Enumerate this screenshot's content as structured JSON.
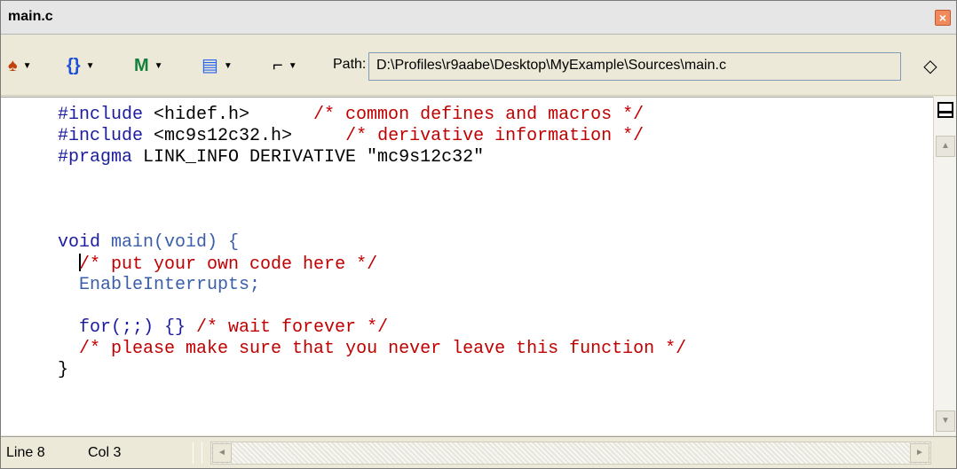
{
  "window": {
    "title": "main.c",
    "close_glyph": "×"
  },
  "toolbar": {
    "icons": [
      {
        "name": "debug-icon",
        "glyph": "♠",
        "color": "#c2410c"
      },
      {
        "name": "braces-icon",
        "glyph": "{}",
        "color": "#1d4ed8"
      },
      {
        "name": "make-icon",
        "glyph": "M",
        "color": "#15803d"
      },
      {
        "name": "list-icon",
        "glyph": "▤",
        "color": "#2563eb"
      },
      {
        "name": "lock-icon",
        "glyph": "⌐",
        "color": "#000000"
      }
    ],
    "dropdown_glyph": "▼",
    "path_label": "Path:",
    "path_value": "D:\\Profiles\\r9aabe\\Desktop\\MyExample\\Sources\\main.c",
    "diamond_glyph": "◇"
  },
  "code_lines": [
    {
      "kw": "#include",
      "rest": " <hidef.h>      ",
      "cm": "/* common defines and macros */"
    },
    {
      "kw": "#include",
      "rest": " <mc9s12c32.h>     ",
      "cm": "/* derivative information */"
    },
    {
      "kw": "#pragma",
      "rest": " LINK_INFO DERIVATIVE \"mc9s12c32\"",
      "cm": ""
    },
    {
      "kw": "",
      "rest": "",
      "cm": ""
    },
    {
      "kw": "",
      "rest": "",
      "cm": ""
    },
    {
      "kw": "",
      "rest": "",
      "cm": ""
    },
    {
      "kw": "void",
      "rest": " main(void) {",
      "cm": ""
    },
    {
      "kw": "",
      "rest": "  ",
      "cm": "/* put your own code here */"
    },
    {
      "kw": "",
      "rest": "  EnableInterrupts;",
      "cm": ""
    },
    {
      "kw": "",
      "rest": "",
      "cm": ""
    },
    {
      "kw": "",
      "rest": "  for(;;) {} ",
      "cm": "/* wait forever */"
    },
    {
      "kw": "",
      "rest": "  ",
      "cm": "/* please make sure that you never leave this function */"
    },
    {
      "kw": "",
      "rest": "}",
      "cm": ""
    }
  ],
  "status": {
    "line": "Line 8",
    "col": "Col 3"
  },
  "colors": {
    "keyword": "#1c1ca0",
    "comment": "#c00000",
    "identifier": "#3a5fa8"
  }
}
